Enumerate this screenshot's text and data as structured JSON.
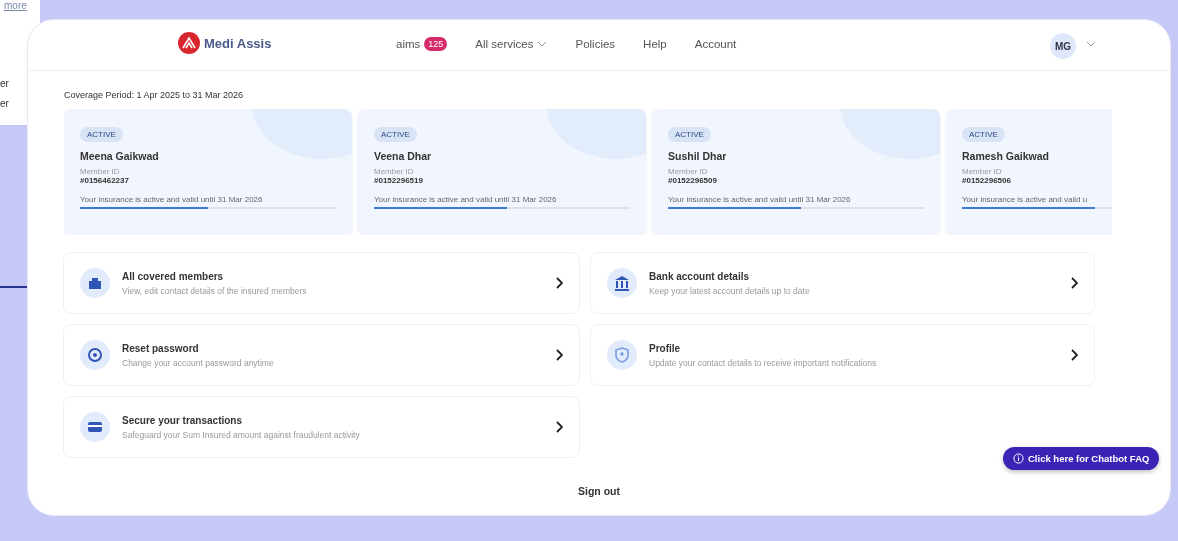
{
  "background_page": {
    "link": "more",
    "fragments": [
      "er",
      "er"
    ]
  },
  "header": {
    "logo": "Medi Assis",
    "nav": [
      {
        "label": "aims",
        "badge": "125"
      },
      {
        "label": "All services",
        "dropdown": true
      },
      {
        "label": "Policies"
      },
      {
        "label": "Help"
      },
      {
        "label": "Account"
      }
    ],
    "avatar": "MG"
  },
  "coverage_period": "Coverage Period: 1 Apr 2025 to 31 Mar 2026",
  "members": [
    {
      "status": "ACTIVE",
      "name": "Meena Gaikwad",
      "id_label": "Member ID",
      "id": "#0156462237",
      "validity": "Your insurance is active and valid until 31 Mar 2026",
      "level": 0.5
    },
    {
      "status": "ACTIVE",
      "name": "Veena Dhar",
      "id_label": "Member ID",
      "id": "#0152296519",
      "validity": "Your insurance is active and valid until 31 Mar 2026",
      "level": 0.52
    },
    {
      "status": "ACTIVE",
      "name": "Sushil Dhar",
      "id_label": "Member ID",
      "id": "#0152296509",
      "validity": "Your insurance is active and valid until 31 Mar 2026",
      "level": 0.52
    },
    {
      "status": "ACTIVE",
      "name": "Ramesh Gaikwad",
      "id_label": "Member ID",
      "id": "#0152296506",
      "validity": "Your insurance is active and valid u",
      "level": 0.52
    }
  ],
  "menu": [
    {
      "kind": "members",
      "title": "All covered members",
      "subtitle": "View, edit contact details of the insured members"
    },
    {
      "kind": "bank",
      "title": "Bank account details",
      "subtitle": "Keep your latest account details up to date"
    },
    {
      "kind": "password",
      "title": "Reset password",
      "subtitle": "Change your account password anytime"
    },
    {
      "kind": "profile",
      "title": "Profile",
      "subtitle": "Update your contact details to receive important notifications"
    },
    {
      "kind": "secure",
      "title": "Secure your transactions",
      "subtitle": "Safeguard your Sum Insured amount against fraudulent activity"
    }
  ],
  "sign_out": "Sign out",
  "chatbot": "Click here for Chatbot FAQ"
}
